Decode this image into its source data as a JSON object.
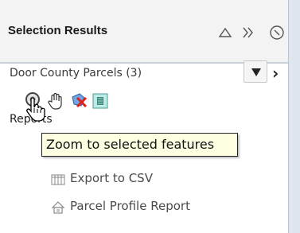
{
  "panel": {
    "title": "Selection Results"
  },
  "layer": {
    "name": "Door County Parcels (3)"
  },
  "section": {
    "label": "Reports"
  },
  "tooltip": {
    "text": "Zoom to selected features"
  },
  "actions": [
    {
      "label": "Export to CSV",
      "icon": "table-icon"
    },
    {
      "label": "Parcel Profile Report",
      "icon": "house-icon"
    }
  ],
  "toolbar": {
    "tools": [
      "zoom-to-selected-icon",
      "pan-hand-icon",
      "clear-selection-icon",
      "select-features-icon"
    ]
  },
  "colors": {
    "tooltip_bg": "#ffffe1",
    "header_bg": "#f3f3f3",
    "rail_bg": "#dfe6ee"
  }
}
